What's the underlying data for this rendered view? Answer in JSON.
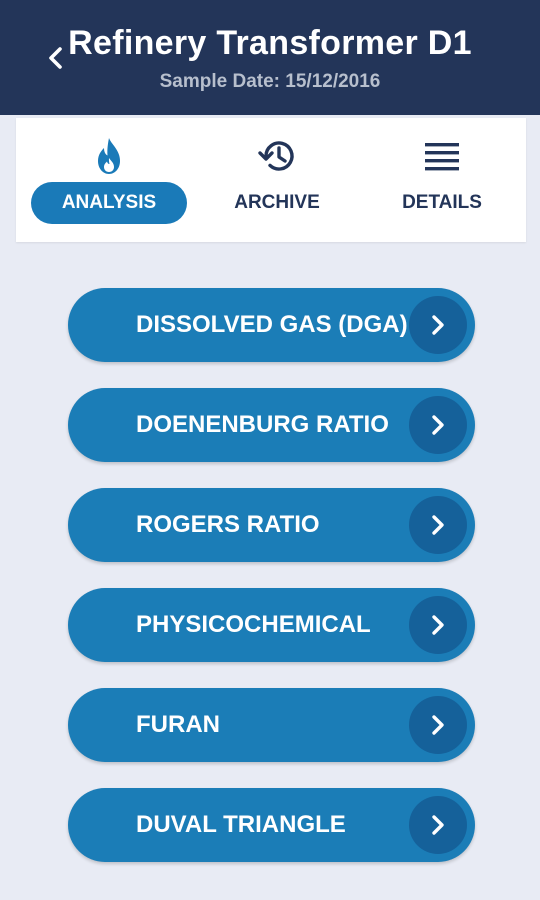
{
  "header": {
    "title": "Refinery Transformer D1",
    "subtitle": "Sample Date: 15/12/2016",
    "back_icon": "chevron-left-icon"
  },
  "tabs": [
    {
      "label": "ANALYSIS",
      "icon": "flame-icon",
      "active": true
    },
    {
      "label": "ARCHIVE",
      "icon": "history-icon",
      "active": false
    },
    {
      "label": "DETAILS",
      "icon": "list-icon",
      "active": false
    }
  ],
  "menu": [
    {
      "label": "DISSOLVED GAS (DGA)",
      "icon": "chevron-right-icon"
    },
    {
      "label": "DOENENBURG RATIO",
      "icon": "chevron-right-icon"
    },
    {
      "label": "ROGERS RATIO",
      "icon": "chevron-right-icon"
    },
    {
      "label": "PHYSICOCHEMICAL",
      "icon": "chevron-right-icon"
    },
    {
      "label": "FURAN",
      "icon": "chevron-right-icon"
    },
    {
      "label": "DUVAL TRIANGLE",
      "icon": "chevron-right-icon"
    }
  ],
  "colors": {
    "header_bg": "#233559",
    "accent": "#1b7db7",
    "accent_dark": "#15619a",
    "background": "#e8ebf4"
  }
}
